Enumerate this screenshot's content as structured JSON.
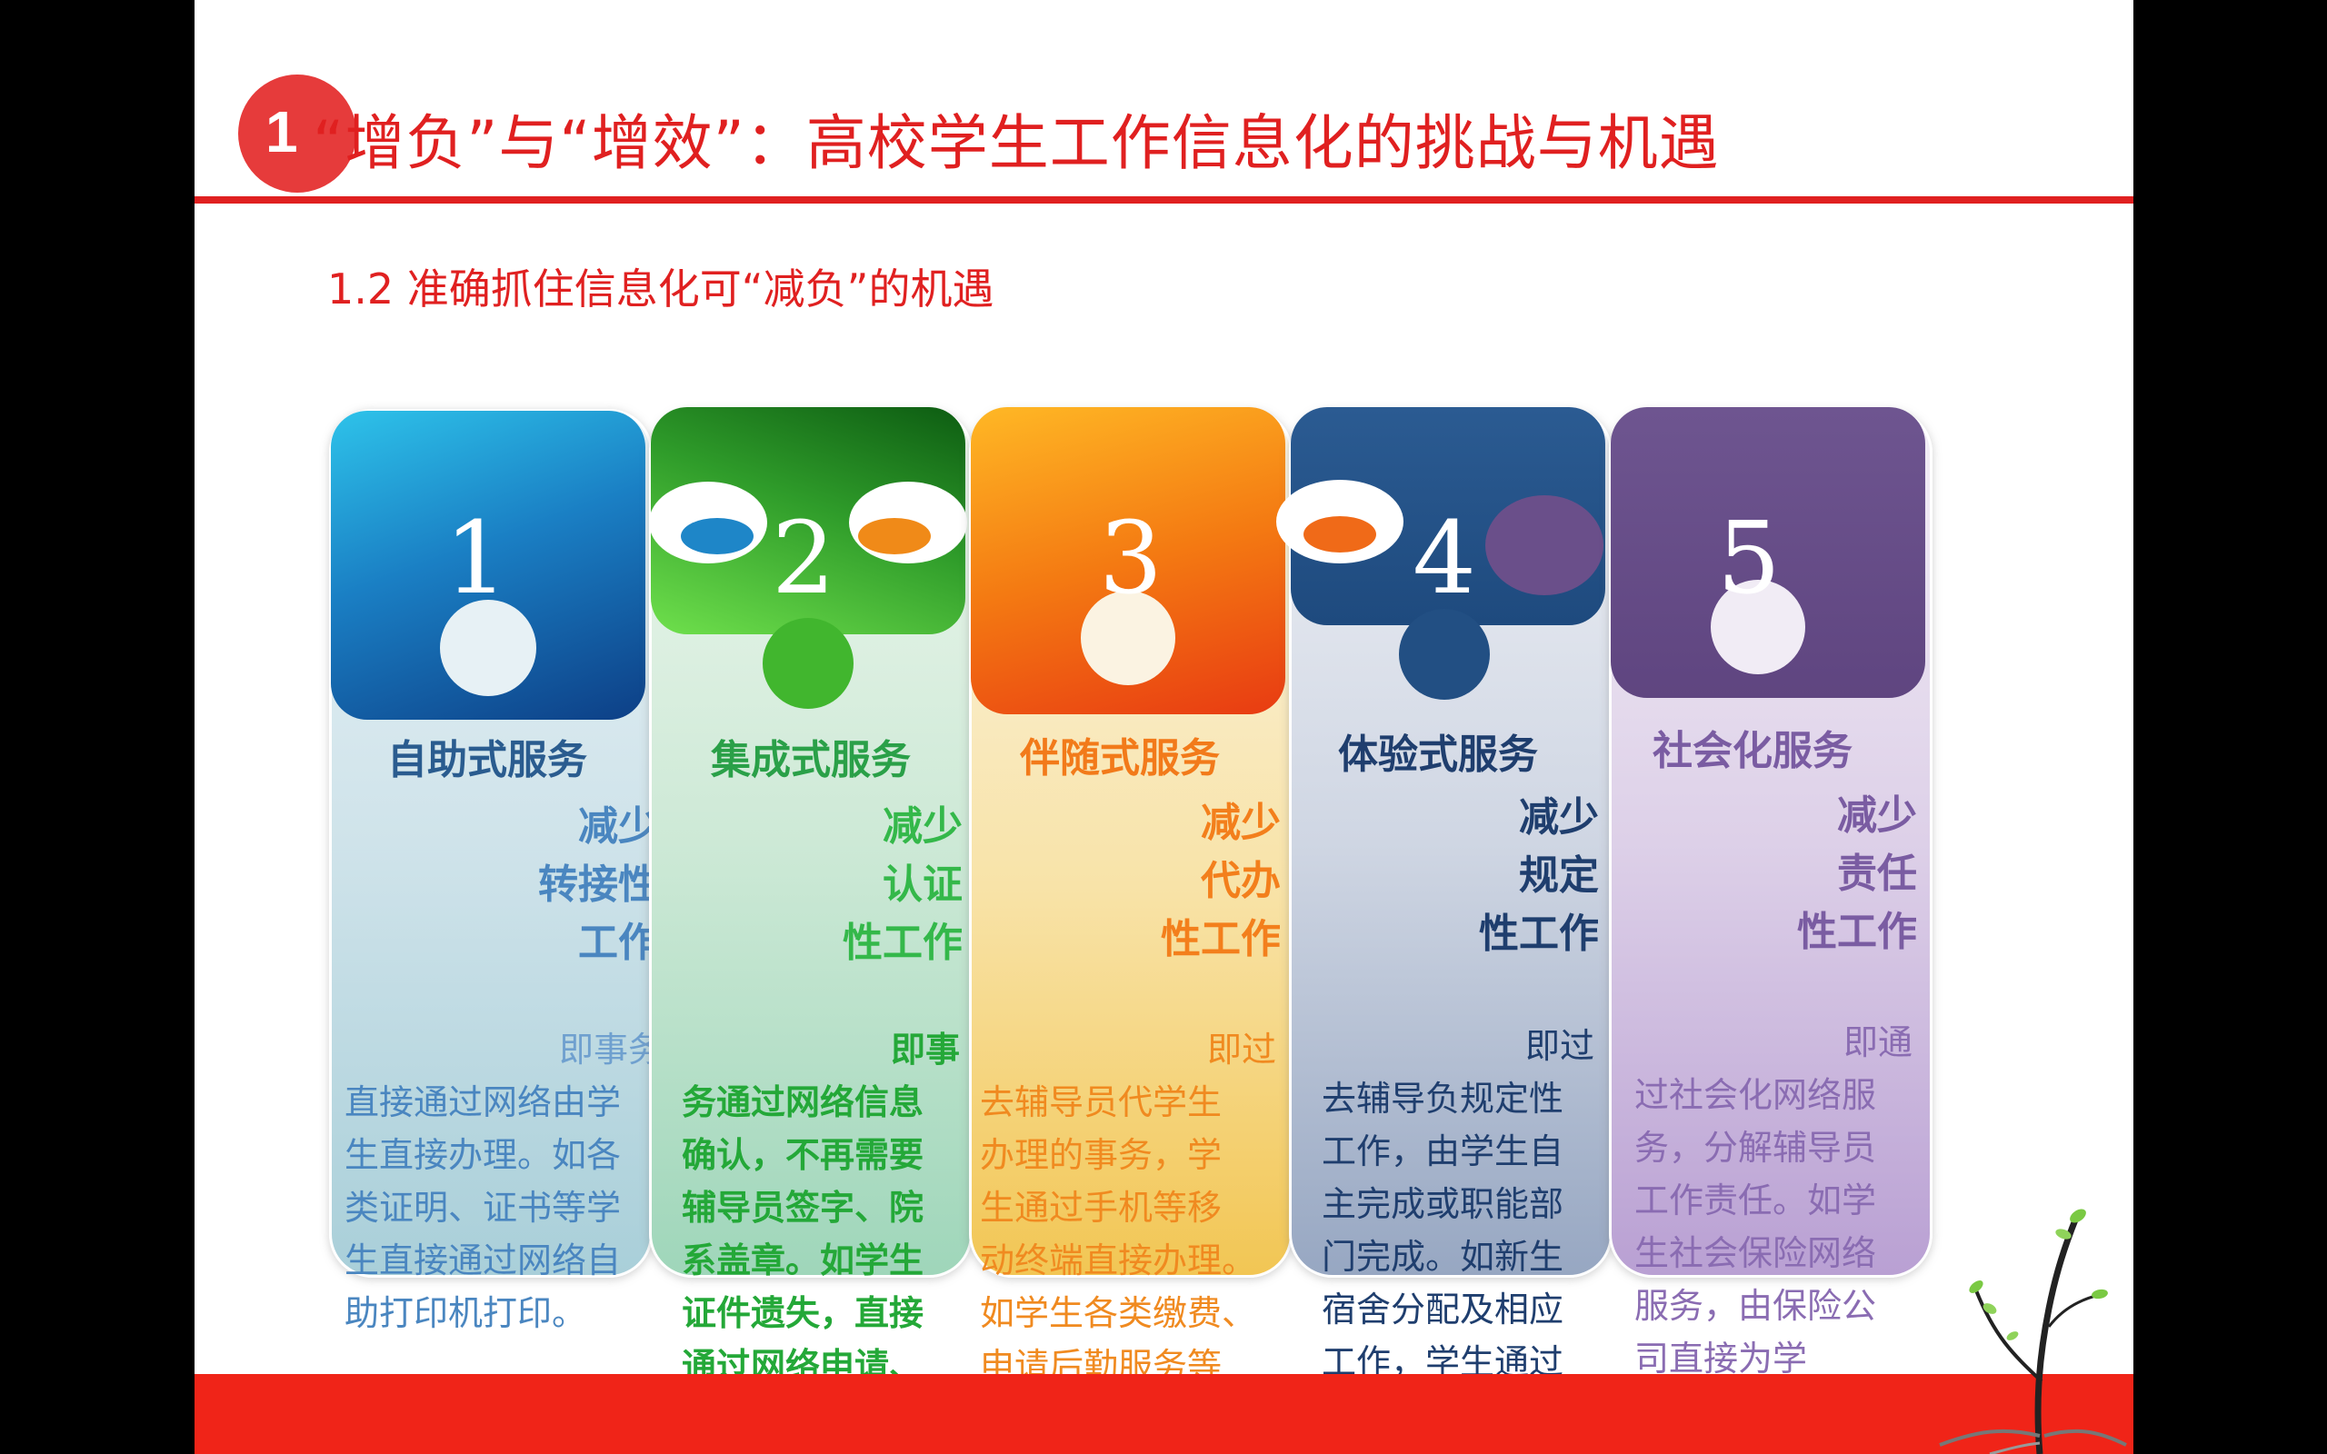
{
  "header": {
    "badge_number": "1",
    "title": "“增负”与“增效”：高校学生工作信息化的挑战与机遇"
  },
  "subtitle": "1.2 准确抓住信息化可“减负”的机遇",
  "colors": {
    "accent_red": "#e02020",
    "piece1": "#1a7fc4",
    "piece2": "#3fb52c",
    "piece3": "#f07a10",
    "piece4": "#1f4f85",
    "piece5": "#6b4f8a"
  },
  "cards": [
    {
      "number": "1",
      "title": "自助式服务",
      "benefit": "减少\n转接性\n工作",
      "desc_head": "即事务",
      "desc": "直接通过网络由学\n生直接办理。如各\n类证明、证书等学\n生直接通过网络自\n助打印机打印。"
    },
    {
      "number": "2",
      "title": "集成式服务",
      "benefit": "减少\n认证\n性工作",
      "desc_head": "即事",
      "desc": "务通过网络信息\n确认，不再需要\n辅导员签字、院\n系盖章。如学生\n证件遗失，直接\n通过网络申请、\n确认和办理。"
    },
    {
      "number": "3",
      "title": "伴随式服务",
      "benefit": "减少\n代办\n性工作",
      "desc_head": "即过",
      "desc": "去辅导员代学生\n办理的事务，学\n生通过手机等移\n动终端直接办理。\n如学生各类缴费、\n申请后勤服务等\n事务。"
    },
    {
      "number": "4",
      "title": "体验式服务",
      "benefit": "减少\n规定\n性工作",
      "desc_head": "即过",
      "desc": "去辅导负规定性\n工作，由学生自\n主完成或职能部\n门完成。如新生\n宿舍分配及相应\n工作，学生通过\n网络完成。"
    },
    {
      "number": "5",
      "title": "社会化服务",
      "benefit": "减少\n责任\n性工作",
      "desc_head": "即通",
      "desc": "过社会化网络服\n务，分解辅导员\n工作责任。如学\n生社会保险网络\n服务，由保险公\n司直接为学\n生提"
    }
  ]
}
